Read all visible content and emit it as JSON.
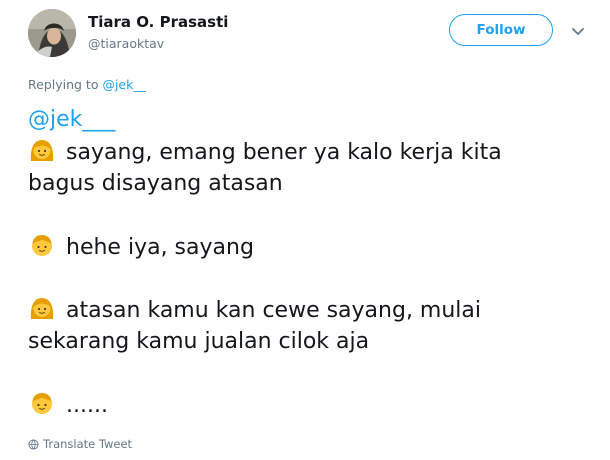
{
  "author": {
    "name": "Tiara O. Prasasti",
    "handle": "@tiaraoktav"
  },
  "follow_button": {
    "label": "Follow"
  },
  "menu": {
    "icon": "chevron-down-icon"
  },
  "reply": {
    "prefix": "Replying to ",
    "to": "@jek__"
  },
  "tweet": {
    "mention": "@jek___",
    "lines": [
      "sayang, emang bener ya kalo kerja kita",
      "bagus disayang atasan",
      "hehe iya, sayang",
      "atasan kamu kan cewe sayang, mulai",
      "sekarang kamu jualan cilok aja",
      "......"
    ],
    "emojis": [
      "girl-emoji",
      "boy-emoji",
      "girl-emoji",
      "boy-emoji"
    ]
  },
  "footer": {
    "translate_label": "Translate Tweet",
    "icon": "globe-icon"
  },
  "colors": {
    "accent": "#1da1f2",
    "text": "#14171a",
    "secondary": "#657786",
    "emoji_skin": "#ffc83d",
    "emoji_hair": "#e5a000"
  }
}
